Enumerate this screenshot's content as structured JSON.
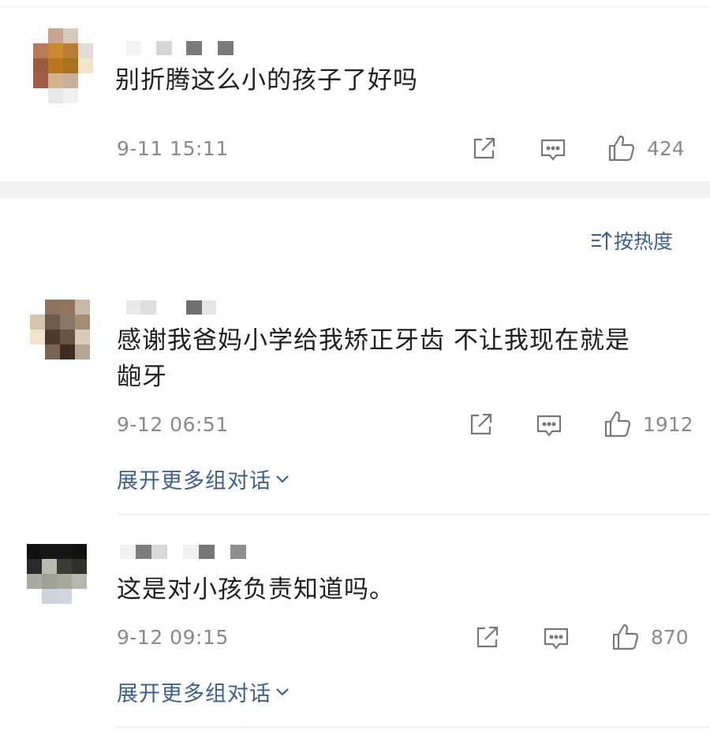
{
  "sort": {
    "label": "按热度"
  },
  "comments": [
    {
      "text": "别折腾这么小的孩子了好吗",
      "time": "9-11 15:11",
      "likes": "424"
    },
    {
      "text": "感谢我爸妈小学给我矫正牙齿  不让我现在就是",
      "text2": "龅牙",
      "time": "9-12 06:51",
      "likes": "1912",
      "expand": "展开更多组对话"
    },
    {
      "text": "这是对小孩负责知道吗。",
      "time": "9-12 09:15",
      "likes": "870",
      "expand": "展开更多组对话"
    }
  ],
  "icons": [
    "share-icon",
    "reply-icon",
    "like-icon",
    "chevron-down-icon",
    "sort-icon"
  ],
  "colors": {
    "link": "#3f6189",
    "meta": "#8a8a8a",
    "text": "#1e1e1e"
  }
}
